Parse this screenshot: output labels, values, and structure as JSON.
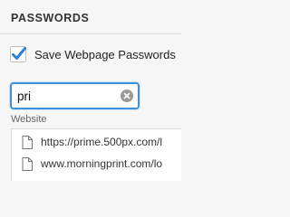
{
  "section": {
    "title": "PASSWORDS"
  },
  "save_passwords": {
    "label": "Save Webpage Passwords",
    "checked": true,
    "checkbox_color": "#2d7fd3"
  },
  "search": {
    "value": "pri",
    "clear_icon": "clear-circle-icon"
  },
  "table": {
    "column_header": "Website",
    "rows": [
      {
        "icon": "document-icon",
        "website": "https://prime.500px.com/l"
      },
      {
        "icon": "document-icon",
        "website": "www.morningprint.com/lo"
      }
    ]
  },
  "colors": {
    "accent": "#3f8fd9",
    "background": "#f6f6f6"
  }
}
